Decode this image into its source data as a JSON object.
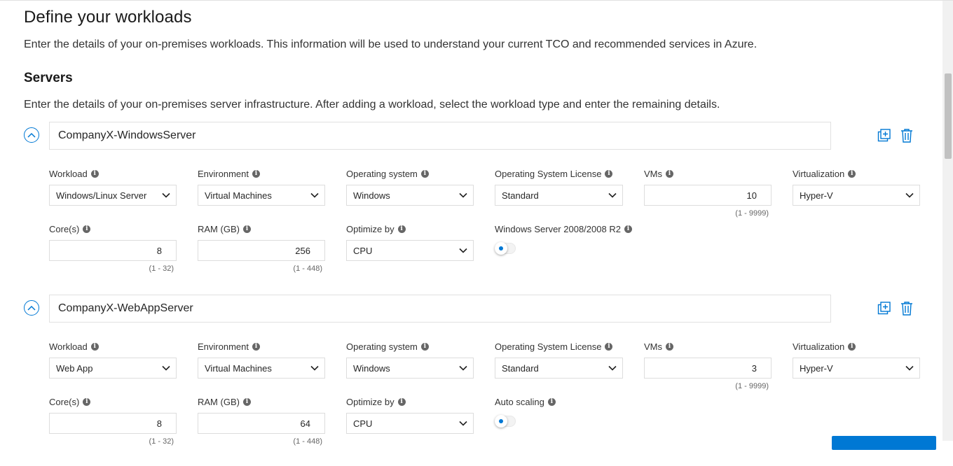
{
  "header": {
    "title": "Define your workloads",
    "description": "Enter the details of your on-premises workloads. This information will be used to understand your current TCO and recommended services in Azure."
  },
  "servers": {
    "title": "Servers",
    "description": "Enter the details of your on-premises server infrastructure. After adding a workload, select the workload type and enter the remaining details."
  },
  "labels": {
    "workload": "Workload",
    "environment": "Environment",
    "os": "Operating system",
    "os_license": "Operating System License",
    "vms": "VMs",
    "virtualization": "Virtualization",
    "cores": "Core(s)",
    "ram": "RAM (GB)",
    "optimize": "Optimize by"
  },
  "workloads": [
    {
      "name": "CompanyX-WindowsServer",
      "workload": "Windows/Linux Server",
      "environment": "Virtual Machines",
      "os": "Windows",
      "os_license": "Standard",
      "vms": "10",
      "vms_range": "(1 - 9999)",
      "virtualization": "Hyper-V",
      "cores": "8",
      "cores_range": "(1 - 32)",
      "ram": "256",
      "ram_range": "(1 - 448)",
      "optimize": "CPU",
      "toggle_label": "Windows Server 2008/2008 R2",
      "toggle_on": false
    },
    {
      "name": "CompanyX-WebAppServer",
      "workload": "Web App",
      "environment": "Virtual Machines",
      "os": "Windows",
      "os_license": "Standard",
      "vms": "3",
      "vms_range": "(1 - 9999)",
      "virtualization": "Hyper-V",
      "cores": "8",
      "cores_range": "(1 - 32)",
      "ram": "64",
      "ram_range": "(1 - 448)",
      "optimize": "CPU",
      "toggle_label": "Auto scaling",
      "toggle_on": false
    }
  ],
  "icons": {
    "collapse": "chevron-up-icon",
    "copy": "copy-icon",
    "delete": "trash-icon",
    "info": "info-icon",
    "dropdown": "chevron-down-icon"
  },
  "colors": {
    "accent": "#0078d4",
    "border": "#dddddd",
    "text": "#262626"
  }
}
